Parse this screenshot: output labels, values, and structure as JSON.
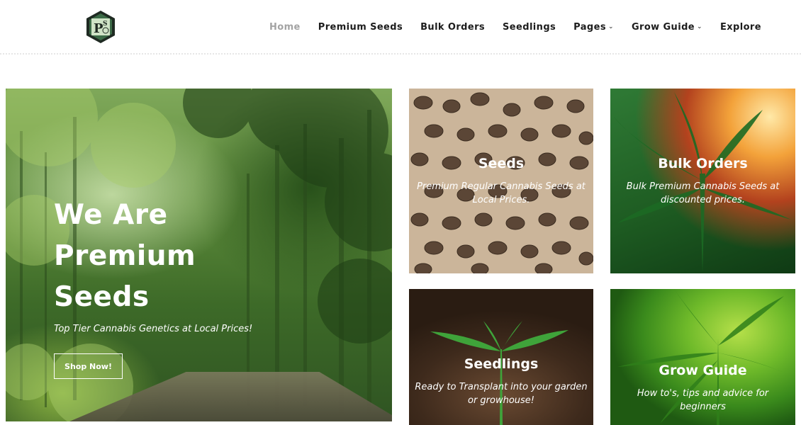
{
  "brand": {
    "logo_letters": "PS"
  },
  "nav": {
    "items": [
      {
        "label": "Home",
        "active": true,
        "dropdown": false
      },
      {
        "label": "Premium Seeds",
        "active": false,
        "dropdown": false
      },
      {
        "label": "Bulk Orders",
        "active": false,
        "dropdown": false
      },
      {
        "label": "Seedlings",
        "active": false,
        "dropdown": false
      },
      {
        "label": "Pages",
        "active": false,
        "dropdown": true
      },
      {
        "label": "Grow Guide",
        "active": false,
        "dropdown": true
      },
      {
        "label": "Explore",
        "active": false,
        "dropdown": false
      }
    ]
  },
  "hero": {
    "title_lines": [
      "We Are",
      "Premium",
      "Seeds"
    ],
    "subtitle": "Top Tier Cannabis Genetics at Local Prices!",
    "button_label": "Shop Now!"
  },
  "cards": [
    {
      "title": "Seeds",
      "description": "Premium Regular Cannabis Seeds at Local Prices."
    },
    {
      "title": "Bulk Orders",
      "description": "Bulk Premium Cannabis Seeds at discounted prices."
    },
    {
      "title": "Seedlings",
      "description": "Ready to Transplant into your garden or growhouse!"
    },
    {
      "title": "Grow Guide",
      "description": "How to's, tips and advice for beginners"
    }
  ],
  "colors": {
    "nav_active": "#a3a3a3",
    "nav_text": "#1d1d1d",
    "logo_green": "#2e5a3a"
  }
}
